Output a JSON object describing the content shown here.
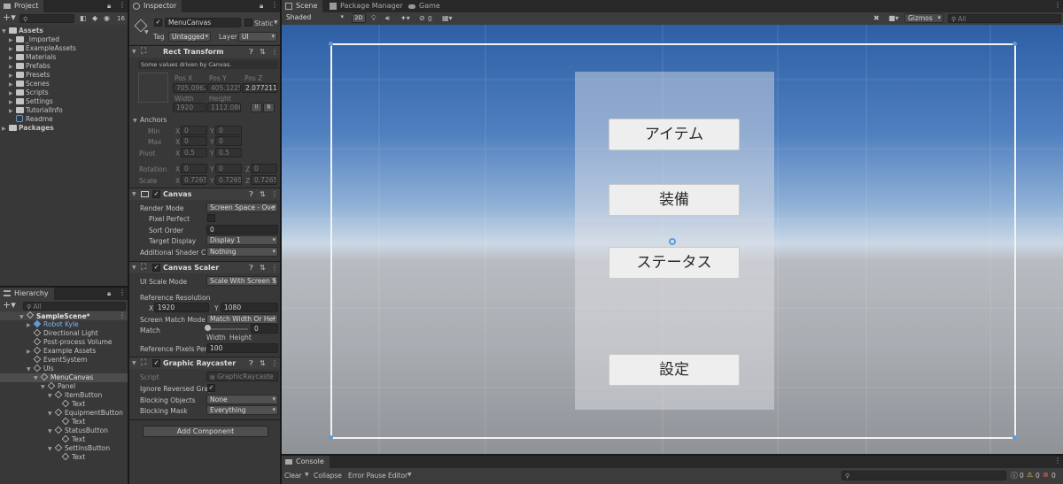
{
  "project": {
    "tab": "Project",
    "count": "16",
    "tree": [
      {
        "label": "Assets",
        "bold": true
      },
      {
        "label": "_Imported"
      },
      {
        "label": "ExampleAssets"
      },
      {
        "label": "Materials"
      },
      {
        "label": "Prefabs"
      },
      {
        "label": "Presets"
      },
      {
        "label": "Scenes"
      },
      {
        "label": "Scripts"
      },
      {
        "label": "Settings"
      },
      {
        "label": "TutorialInfo"
      },
      {
        "label": "Readme"
      },
      {
        "label": "Packages",
        "bold": true
      }
    ]
  },
  "hierarchy": {
    "tab": "Hierarchy",
    "search_placeholder": "All",
    "scene": "SampleScene*",
    "items": [
      {
        "label": "Robot Kyle"
      },
      {
        "label": "Directional Light"
      },
      {
        "label": "Post-process Volume"
      },
      {
        "label": "Example Assets"
      },
      {
        "label": "EventSystem"
      },
      {
        "label": "UIs"
      },
      {
        "label": "MenuCanvas"
      },
      {
        "label": "Panel"
      },
      {
        "label": "ItemButton"
      },
      {
        "label": "Text"
      },
      {
        "label": "EquipmentButton"
      },
      {
        "label": "Text"
      },
      {
        "label": "StatusButton"
      },
      {
        "label": "Text"
      },
      {
        "label": "SettinsButton"
      },
      {
        "label": "Text"
      }
    ]
  },
  "inspector": {
    "tab": "Inspector",
    "object_name": "MenuCanvas",
    "static_label": "Static",
    "tag_label": "Tag",
    "tag_value": "Untagged",
    "layer_label": "Layer",
    "layer_value": "UI",
    "rect": {
      "title": "Rect Transform",
      "note": "Some values driven by Canvas.",
      "posx_label": "Pos X",
      "posy_label": "Pos Y",
      "posz_label": "Pos Z",
      "posx": "705.0962",
      "posy": "405.1225",
      "posz": "2.077211",
      "width_label": "Width",
      "height_label": "Height",
      "width": "1920",
      "height": "1112.086",
      "r_label": "R",
      "anchors_label": "Anchors",
      "min_label": "Min",
      "max_label": "Max",
      "pivot_label": "Pivot",
      "min_x": "0",
      "min_y": "0",
      "max_x": "0",
      "max_y": "0",
      "pivot_x": "0.5",
      "pivot_y": "0.5",
      "rotation_label": "Rotation",
      "scale_label": "Scale",
      "rot_x": "0",
      "rot_y": "0",
      "rot_z": "0",
      "scale_x": "0.72656",
      "scale_y": "0.72656",
      "scale_z": "0.72656",
      "x": "X",
      "y": "Y",
      "z": "Z"
    },
    "canvas": {
      "title": "Canvas",
      "render_mode_label": "Render Mode",
      "render_mode": "Screen Space - Ove",
      "pixel_perfect_label": "Pixel Perfect",
      "sort_order_label": "Sort Order",
      "sort_order": "0",
      "target_display_label": "Target Display",
      "target_display": "Display 1",
      "shader_label": "Additional Shader Ch",
      "shader": "Nothing"
    },
    "scaler": {
      "title": "Canvas Scaler",
      "ui_scale_label": "UI Scale Mode",
      "ui_scale": "Scale With Screen S",
      "ref_res_label": "Reference Resolution",
      "ref_x": "1920",
      "ref_y": "1080",
      "match_mode_label": "Screen Match Mode",
      "match_mode": "Match Width Or Hei",
      "match_label": "Match",
      "match_value": "0",
      "match_fraction": 0,
      "width_word": "Width",
      "height_word": "Height",
      "ref_ppu_label": "Reference Pixels Per",
      "ref_ppu": "100"
    },
    "raycaster": {
      "title": "Graphic Raycaster",
      "script_label": "Script",
      "script": "GraphicRaycaste",
      "ignore_label": "Ignore Reversed Grap",
      "blocking_objects_label": "Blocking Objects",
      "blocking_objects": "None",
      "blocking_mask_label": "Blocking Mask",
      "blocking_mask": "Everything"
    },
    "add_component": "Add Component"
  },
  "scene": {
    "tabs": [
      "Scene",
      "Package Manager",
      "Game"
    ],
    "shading": "Shaded",
    "mode_2d": "2D",
    "hidden_count": "0",
    "gizmos": "Gizmos",
    "search_placeholder": "All",
    "buttons": [
      "アイテム",
      "装備",
      "ステータス",
      "設定"
    ]
  },
  "console": {
    "tab": "Console",
    "clear": "Clear",
    "collapse": "Collapse",
    "error_pause": "Error Pause",
    "editor": "Editor",
    "count_log": "0",
    "count_warn": "0",
    "count_err": "0"
  },
  "colors": {
    "accent_blue": "#5c9bd6",
    "panel_bg": "#383838",
    "scene_sky": "#2e5fa5"
  }
}
